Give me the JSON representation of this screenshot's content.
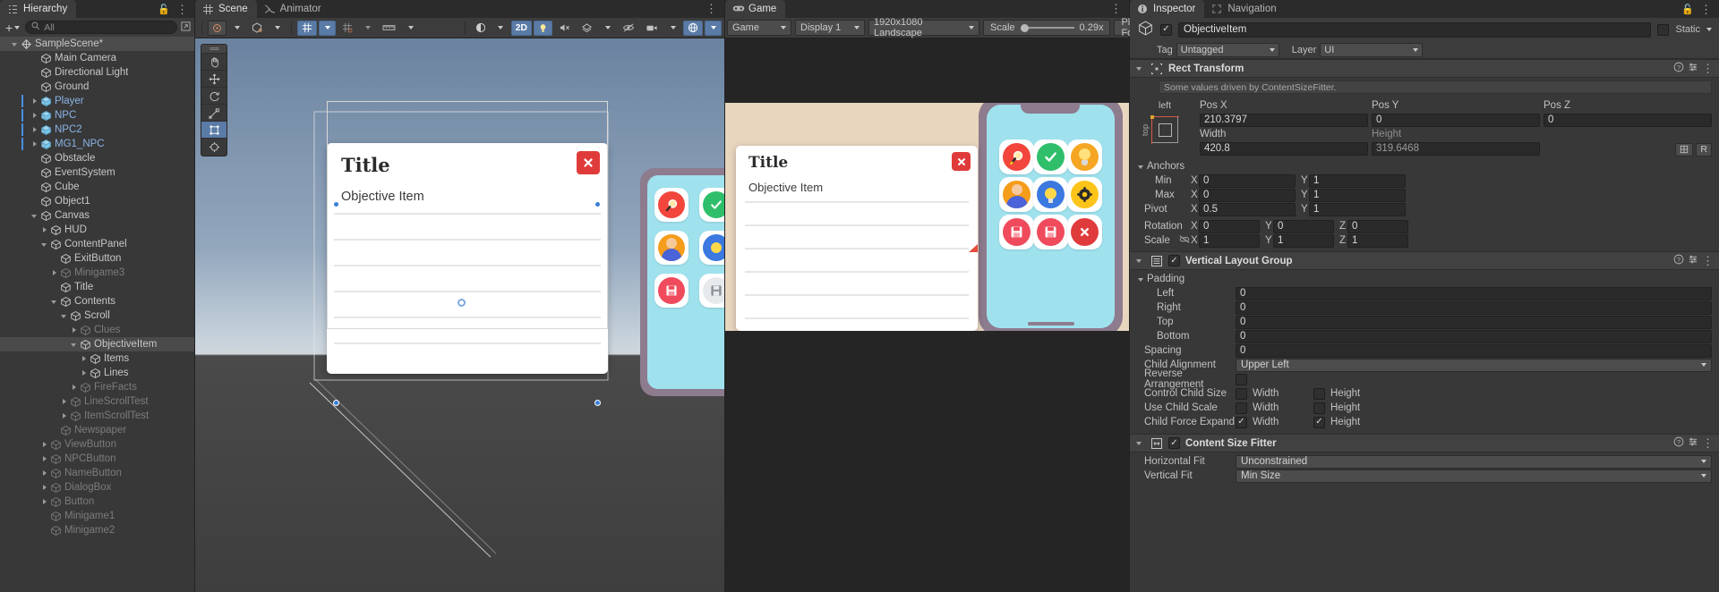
{
  "hierarchy": {
    "tab_label": "Hierarchy",
    "create_label": "+",
    "search_placeholder": "All",
    "rows": [
      {
        "label": "SampleScene*",
        "depth": 0,
        "arrow": "open",
        "icon": "unity-scene-icon",
        "state": "scene",
        "prefab": false
      },
      {
        "label": "Main Camera",
        "depth": 2,
        "arrow": "none",
        "icon": "gameobject-icon",
        "state": "normal",
        "prefab": false
      },
      {
        "label": "Directional Light",
        "depth": 2,
        "arrow": "none",
        "icon": "gameobject-icon",
        "state": "normal",
        "prefab": false
      },
      {
        "label": "Ground",
        "depth": 2,
        "arrow": "none",
        "icon": "gameobject-icon",
        "state": "normal",
        "prefab": false
      },
      {
        "label": "Player",
        "depth": 2,
        "arrow": "closed",
        "icon": "prefab-icon",
        "state": "blue",
        "prefab": true
      },
      {
        "label": "NPC",
        "depth": 2,
        "arrow": "closed",
        "icon": "prefab-icon",
        "state": "blue",
        "prefab": true
      },
      {
        "label": "NPC2",
        "depth": 2,
        "arrow": "closed",
        "icon": "prefab-icon",
        "state": "blue",
        "prefab": true
      },
      {
        "label": "MG1_NPC",
        "depth": 2,
        "arrow": "closed",
        "icon": "prefab-icon",
        "state": "blue",
        "prefab": true
      },
      {
        "label": "Obstacle",
        "depth": 2,
        "arrow": "none",
        "icon": "gameobject-icon",
        "state": "normal",
        "prefab": false
      },
      {
        "label": "EventSystem",
        "depth": 2,
        "arrow": "none",
        "icon": "gameobject-icon",
        "state": "normal",
        "prefab": false
      },
      {
        "label": "Cube",
        "depth": 2,
        "arrow": "none",
        "icon": "gameobject-icon",
        "state": "normal",
        "prefab": false
      },
      {
        "label": "Object1",
        "depth": 2,
        "arrow": "none",
        "icon": "gameobject-icon",
        "state": "normal",
        "prefab": false
      },
      {
        "label": "Canvas",
        "depth": 2,
        "arrow": "open",
        "icon": "gameobject-icon",
        "state": "normal",
        "prefab": false
      },
      {
        "label": "HUD",
        "depth": 3,
        "arrow": "closed",
        "icon": "gameobject-icon",
        "state": "normal",
        "prefab": false
      },
      {
        "label": "ContentPanel",
        "depth": 3,
        "arrow": "open",
        "icon": "gameobject-icon",
        "state": "normal",
        "prefab": false
      },
      {
        "label": "ExitButton",
        "depth": 4,
        "arrow": "none",
        "icon": "gameobject-icon",
        "state": "normal",
        "prefab": false
      },
      {
        "label": "Minigame3",
        "depth": 4,
        "arrow": "closed",
        "icon": "gameobject-icon",
        "state": "dim",
        "prefab": false
      },
      {
        "label": "Title",
        "depth": 4,
        "arrow": "none",
        "icon": "gameobject-icon",
        "state": "normal",
        "prefab": false
      },
      {
        "label": "Contents",
        "depth": 4,
        "arrow": "open",
        "icon": "gameobject-icon",
        "state": "normal",
        "prefab": false
      },
      {
        "label": "Scroll",
        "depth": 5,
        "arrow": "open",
        "icon": "gameobject-icon",
        "state": "normal",
        "prefab": false
      },
      {
        "label": "Clues",
        "depth": 6,
        "arrow": "closed",
        "icon": "gameobject-icon",
        "state": "dim",
        "prefab": false
      },
      {
        "label": "ObjectiveItem",
        "depth": 6,
        "arrow": "open",
        "icon": "gameobject-icon",
        "state": "selected",
        "prefab": false
      },
      {
        "label": "Items",
        "depth": 7,
        "arrow": "closed",
        "icon": "gameobject-icon",
        "state": "normal",
        "prefab": false
      },
      {
        "label": "Lines",
        "depth": 7,
        "arrow": "closed",
        "icon": "gameobject-icon",
        "state": "normal",
        "prefab": false
      },
      {
        "label": "FireFacts",
        "depth": 6,
        "arrow": "closed",
        "icon": "gameobject-icon",
        "state": "dim",
        "prefab": false
      },
      {
        "label": "LineScrollTest",
        "depth": 5,
        "arrow": "closed",
        "icon": "gameobject-icon",
        "state": "dim",
        "prefab": false
      },
      {
        "label": "ItemScrollTest",
        "depth": 5,
        "arrow": "closed",
        "icon": "gameobject-icon",
        "state": "dim",
        "prefab": false
      },
      {
        "label": "Newspaper",
        "depth": 4,
        "arrow": "none",
        "icon": "gameobject-icon",
        "state": "dim",
        "prefab": false
      },
      {
        "label": "ViewButton",
        "depth": 3,
        "arrow": "closed",
        "icon": "gameobject-icon",
        "state": "dim",
        "prefab": false
      },
      {
        "label": "NPCButton",
        "depth": 3,
        "arrow": "closed",
        "icon": "gameobject-icon",
        "state": "dim",
        "prefab": false
      },
      {
        "label": "NameButton",
        "depth": 3,
        "arrow": "closed",
        "icon": "gameobject-icon",
        "state": "dim",
        "prefab": false
      },
      {
        "label": "DialogBox",
        "depth": 3,
        "arrow": "closed",
        "icon": "gameobject-icon",
        "state": "dim",
        "prefab": false
      },
      {
        "label": "Button",
        "depth": 3,
        "arrow": "closed",
        "icon": "gameobject-icon",
        "state": "dim",
        "prefab": false
      },
      {
        "label": "Minigame1",
        "depth": 3,
        "arrow": "none",
        "icon": "gameobject-icon",
        "state": "dim",
        "prefab": false
      },
      {
        "label": "Minigame2",
        "depth": 3,
        "arrow": "none",
        "icon": "gameobject-icon",
        "state": "dim",
        "prefab": false
      }
    ]
  },
  "scene": {
    "tabs": [
      {
        "label": "Scene",
        "icon": "scene-icon",
        "active": true
      },
      {
        "label": "Animator",
        "icon": "animator-icon",
        "active": false
      }
    ],
    "toolbar": {
      "draw_mode": "shaded-dropdown",
      "two_d_label": "2D",
      "lighting_icon": "lightbulb-icon",
      "audio_icon": "audio-icon",
      "fx_icon": "effects-icon",
      "hidden_icon": "visibility-icon",
      "camera_icon": "camera-icon",
      "gizmos_icon": "gizmos-icon",
      "grid_icon": "grid-icon",
      "snap_icon": "snap-icon",
      "ruler_icon": "ruler-icon"
    },
    "tools": [
      "hand-tool",
      "move-tool",
      "rotate-tool",
      "scale-tool",
      "rect-tool",
      "transform-tool"
    ],
    "active_tool": "rect-tool",
    "ui_panel": {
      "title": "Title",
      "objective": "Objective Item",
      "close_label": "✖"
    }
  },
  "game": {
    "tab_label": "Game",
    "tab_icon": "game-icon",
    "display_mode": "Game",
    "display": "Display 1",
    "resolution": "1920x1080 Landscape",
    "scale_label": "Scale",
    "scale_value": "0.29x",
    "play_focused": "Play Focused",
    "ui_panel": {
      "title": "Title",
      "objective": "Objective Item",
      "close_label": "✖"
    }
  },
  "inspector": {
    "tabs": [
      {
        "label": "Inspector",
        "icon": "inspector-icon",
        "active": true
      },
      {
        "label": "Navigation",
        "icon": "navigation-icon",
        "active": false
      }
    ],
    "object_name": "ObjectiveItem",
    "enabled": true,
    "static_label": "Static",
    "tag_label": "Tag",
    "tag_value": "Untagged",
    "layer_label": "Layer",
    "layer_value": "UI",
    "rect_transform": {
      "title": "Rect Transform",
      "driven_note": "Some values driven by ContentSizeFitter.",
      "anchor_preset_h": "left",
      "anchor_preset_v": "top",
      "pos_x_label": "Pos X",
      "pos_x": "210.3797",
      "pos_y_label": "Pos Y",
      "pos_y": "0",
      "pos_z_label": "Pos Z",
      "pos_z": "0",
      "width_label": "Width",
      "width": "420.8",
      "height_label": "Height",
      "height": "319.6468",
      "anchors_label": "Anchors",
      "min_label": "Min",
      "min_x": "0",
      "min_y": "1",
      "max_label": "Max",
      "max_x": "0",
      "max_y": "1",
      "pivot_label": "Pivot",
      "pivot_x": "0.5",
      "pivot_y": "1",
      "rotation_label": "Rotation",
      "rot_x": "0",
      "rot_y": "0",
      "rot_z": "0",
      "scale_label": "Scale",
      "scale_x": "1",
      "scale_y": "1",
      "scale_z": "1",
      "blueprint_label": "R"
    },
    "vertical_layout_group": {
      "title": "Vertical Layout Group",
      "enabled": true,
      "padding_label": "Padding",
      "left_label": "Left",
      "left": "0",
      "right_label": "Right",
      "right": "0",
      "top_label": "Top",
      "top": "0",
      "bottom_label": "Bottom",
      "bottom": "0",
      "spacing_label": "Spacing",
      "spacing": "0",
      "child_alignment_label": "Child Alignment",
      "child_alignment": "Upper Left",
      "reverse_label": "Reverse Arrangement",
      "reverse": false,
      "control_child_size_label": "Control Child Size",
      "use_child_scale_label": "Use Child Scale",
      "child_force_expand_label": "Child Force Expand",
      "width_label": "Width",
      "height_label": "Height",
      "control_width": false,
      "control_height": false,
      "scale_width": false,
      "scale_height": false,
      "expand_width": true,
      "expand_height": true
    },
    "content_size_fitter": {
      "title": "Content Size Fitter",
      "enabled": true,
      "horizontal_label": "Horizontal Fit",
      "horizontal": "Unconstrained",
      "vertical_label": "Vertical Fit",
      "vertical": "Min Size"
    }
  },
  "colors": {
    "accent": "#5a7ba6",
    "panel_bg": "#383838",
    "header_bg": "#3c3c3c",
    "prefab_blue": "#8ab4e8",
    "close_red": "#e03b3b"
  }
}
